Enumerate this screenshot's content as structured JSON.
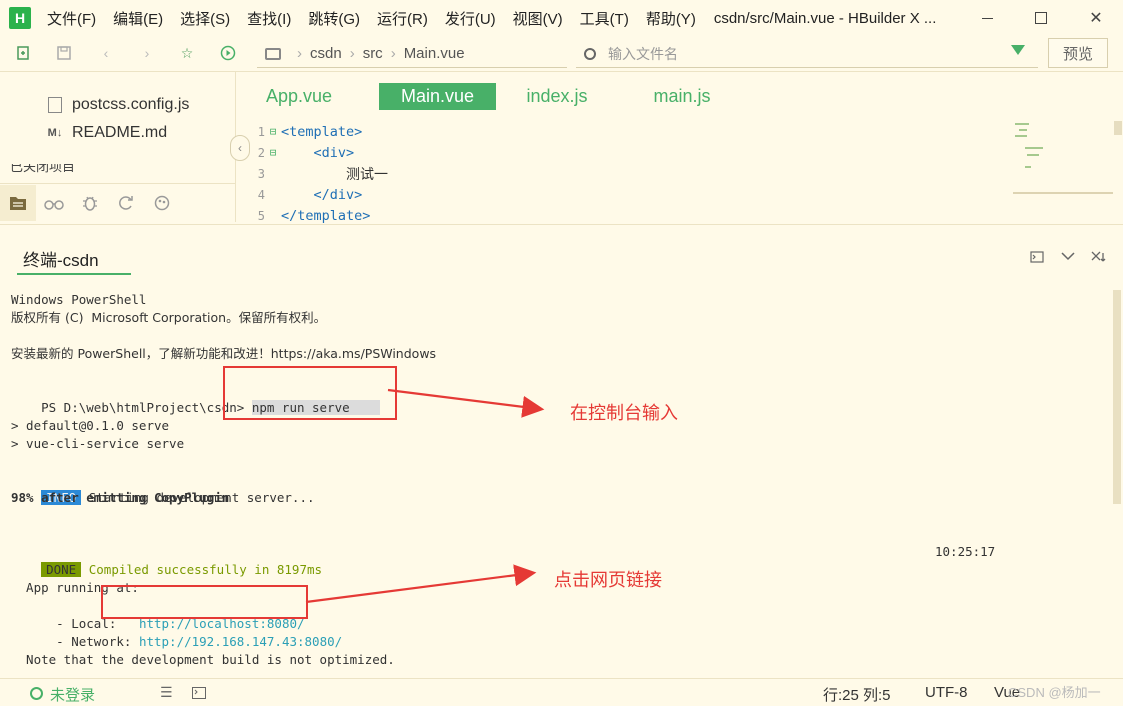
{
  "app": {
    "logo_letter": "H",
    "window_title": "csdn/src/Main.vue - HBuilder X ...",
    "menu": [
      "文件(F)",
      "编辑(E)",
      "选择(S)",
      "查找(I)",
      "跳转(G)",
      "运行(R)",
      "发行(U)",
      "视图(V)",
      "工具(T)",
      "帮助(Y)"
    ]
  },
  "toolbar": {
    "breadcrumb": [
      "csdn",
      "src",
      "Main.vue"
    ],
    "breadcrumb_sep": "›",
    "search_placeholder": "输入文件名",
    "preview_label": "预览"
  },
  "sidebar": {
    "files": [
      {
        "name": "postcss.config.js",
        "icon": "file-icon"
      },
      {
        "name": "README.md",
        "icon": "markdown-icon"
      }
    ],
    "closed_projects_label": "已关闭项目",
    "collapse_glyph": "‹"
  },
  "editor": {
    "tabs": [
      {
        "label": "App.vue",
        "active": false
      },
      {
        "label": "Main.vue",
        "active": true
      },
      {
        "label": "index.js",
        "active": false
      },
      {
        "label": "main.js",
        "active": false
      }
    ],
    "code_lines": [
      {
        "num": "1",
        "fold": "⊟",
        "indent": "",
        "text": "<template>",
        "kind": "tag"
      },
      {
        "num": "2",
        "fold": "⊟",
        "indent": "    ",
        "text": "<div>",
        "kind": "tag"
      },
      {
        "num": "3",
        "fold": "",
        "indent": "        ",
        "text": "测试一",
        "kind": "text"
      },
      {
        "num": "4",
        "fold": "",
        "indent": "    ",
        "text": "</div>",
        "kind": "tag"
      },
      {
        "num": "5",
        "fold": "",
        "indent": "",
        "text": "</template>",
        "kind": "tag"
      }
    ]
  },
  "terminal": {
    "tab_label": "终端-csdn",
    "lines": {
      "l1": "Windows PowerShell",
      "l2": "版权所有 (C)  Microsoft Corporation。保留所有权利。",
      "l3": "安装最新的 PowerShell，了解新功能和改进！https://aka.ms/PSWindows",
      "prompt": "PS D:\\web\\htmlProject\\csdn> ",
      "command": "npm run serve",
      "l5": "> default@0.1.0 serve",
      "l6": "> vue-cli-service serve",
      "info_badge": "INFO",
      "info_text": " Starting development server...",
      "progress": "98% after emitting CopyPlugin",
      "done_badge": "DONE",
      "done_text": " Compiled successfully in 8197ms",
      "time": "10:25:17",
      "app_running": "  App running at:",
      "local_label": "  - Local:   ",
      "local_url": "http://localhost:8080/",
      "network_label": "  - Network: ",
      "network_url": "http://192.168.147.43:8080/",
      "note": "  Note that the development build is not optimized."
    }
  },
  "annotations": {
    "label1": "在控制台输入",
    "label2": "点击网页链接",
    "color": "#e53935"
  },
  "statusbar": {
    "login": "未登录",
    "position": "行:25  列:5",
    "encoding": "UTF-8",
    "language": "Vue",
    "watermark": "CSDN @杨加一"
  },
  "colors": {
    "accent": "#48b068",
    "background": "#fffae8",
    "tag": "#1f6fb5",
    "link": "#2b9fb6"
  }
}
